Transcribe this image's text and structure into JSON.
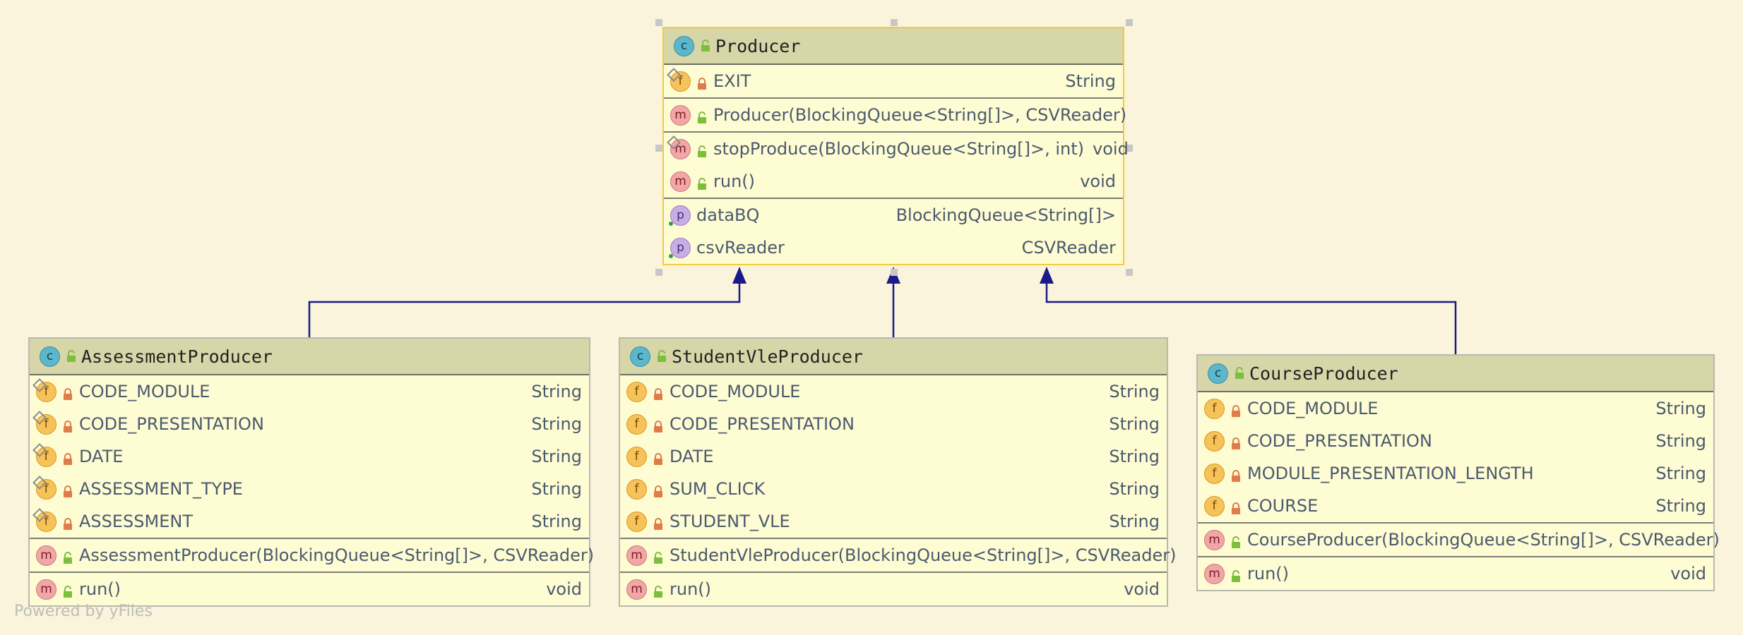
{
  "watermark": "Powered by yFiles",
  "classes": {
    "producer": {
      "name": "Producer",
      "fields": [
        {
          "icon": "f",
          "name": "EXIT",
          "type": "String",
          "visibility": "private",
          "static": true
        }
      ],
      "constructors": [
        {
          "icon": "m",
          "name": "Producer(BlockingQueue<String[]>, CSVReader)",
          "type": "",
          "visibility": "public"
        }
      ],
      "methods": [
        {
          "icon": "m",
          "name": "stopProduce(BlockingQueue<String[]>, int)",
          "type": "void",
          "visibility": "public",
          "static": true
        },
        {
          "icon": "m",
          "name": "run()",
          "type": "void",
          "visibility": "public"
        }
      ],
      "properties": [
        {
          "icon": "p",
          "name": "dataBQ",
          "type": "BlockingQueue<String[]>"
        },
        {
          "icon": "p",
          "name": "csvReader",
          "type": "CSVReader"
        }
      ]
    },
    "assessment": {
      "name": "AssessmentProducer",
      "fields": [
        {
          "icon": "f",
          "name": "CODE_MODULE",
          "type": "String",
          "static": true
        },
        {
          "icon": "f",
          "name": "CODE_PRESENTATION",
          "type": "String",
          "static": true
        },
        {
          "icon": "f",
          "name": "DATE",
          "type": "String",
          "static": true
        },
        {
          "icon": "f",
          "name": "ASSESSMENT_TYPE",
          "type": "String",
          "static": true
        },
        {
          "icon": "f",
          "name": "ASSESSMENT",
          "type": "String",
          "static": true
        }
      ],
      "constructors": [
        {
          "icon": "m",
          "name": "AssessmentProducer(BlockingQueue<String[]>, CSVReader)",
          "type": ""
        }
      ],
      "methods": [
        {
          "icon": "m",
          "name": "run()",
          "type": "void"
        }
      ]
    },
    "studentvle": {
      "name": "StudentVleProducer",
      "fields": [
        {
          "icon": "f",
          "name": "CODE_MODULE",
          "type": "String"
        },
        {
          "icon": "f",
          "name": "CODE_PRESENTATION",
          "type": "String"
        },
        {
          "icon": "f",
          "name": "DATE",
          "type": "String"
        },
        {
          "icon": "f",
          "name": "SUM_CLICK",
          "type": "String"
        },
        {
          "icon": "f",
          "name": "STUDENT_VLE",
          "type": "String"
        }
      ],
      "constructors": [
        {
          "icon": "m",
          "name": "StudentVleProducer(BlockingQueue<String[]>, CSVReader)",
          "type": ""
        }
      ],
      "methods": [
        {
          "icon": "m",
          "name": "run()",
          "type": "void"
        }
      ]
    },
    "course": {
      "name": "CourseProducer",
      "fields": [
        {
          "icon": "f",
          "name": "CODE_MODULE",
          "type": "String"
        },
        {
          "icon": "f",
          "name": "CODE_PRESENTATION",
          "type": "String"
        },
        {
          "icon": "f",
          "name": "MODULE_PRESENTATION_LENGTH",
          "type": "String"
        },
        {
          "icon": "f",
          "name": "COURSE",
          "type": "String"
        }
      ],
      "constructors": [
        {
          "icon": "m",
          "name": "CourseProducer(BlockingQueue<String[]>, CSVReader)",
          "type": ""
        }
      ],
      "methods": [
        {
          "icon": "m",
          "name": "run()",
          "type": "void"
        }
      ]
    }
  },
  "colors": {
    "edge": "#1b1a8a",
    "header": "#d7d6a8",
    "body": "#fefcd3",
    "selection": "#f0cb3c",
    "lock": "#e07b4a",
    "unlock": "#7cbf3c"
  }
}
